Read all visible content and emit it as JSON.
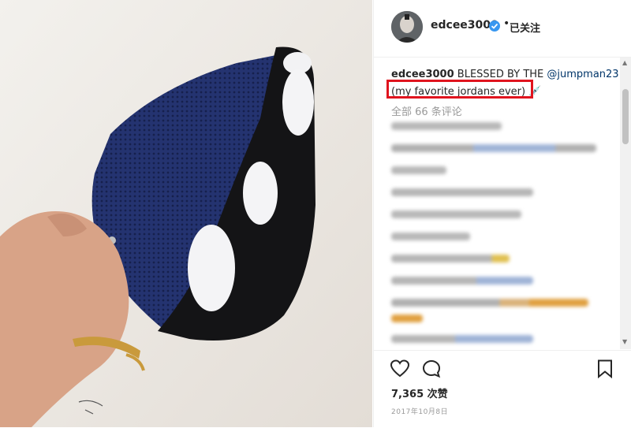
{
  "post": {
    "username": "edcee3000",
    "follow_label": "已关注",
    "separator": "•",
    "caption": {
      "username": "edcee3000",
      "text": "BLESSED BY THE",
      "mention": "@jumpman23",
      "line2": "(my favorite jordans ever) 💉"
    },
    "view_all_comments": "全部 66 条评论",
    "likes": "7,365 次赞",
    "date": "2017年10月8日"
  },
  "icons": {
    "verified": "verified-badge-icon",
    "like": "heart-icon",
    "comment": "comment-bubble-icon",
    "save": "bookmark-icon"
  },
  "colors": {
    "highlight_box": "#e0141e",
    "mention": "#003569",
    "verified": "#3897f0"
  }
}
